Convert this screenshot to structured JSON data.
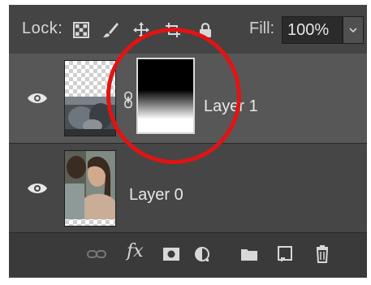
{
  "lockbar": {
    "lock_label": "Lock:",
    "lock_icons": [
      "lock-transparent-pixels-icon",
      "lock-image-pixels-icon",
      "lock-position-icon",
      "artboard-autonest-icon",
      "lock-all-icon"
    ],
    "fill_label": "Fill:",
    "fill_value": "100%"
  },
  "layers": [
    {
      "name": "Layer 1",
      "visible": true,
      "has_mask": true,
      "linked": true,
      "selected": true
    },
    {
      "name": "Layer 0",
      "visible": true,
      "has_mask": false,
      "linked": false,
      "selected": false
    }
  ],
  "footer_icons": [
    "link-layers-icon",
    "fx-icon",
    "add-mask-icon",
    "adjustment-layer-icon",
    "new-group-icon",
    "new-layer-icon",
    "delete-icon"
  ],
  "footer": {
    "fx_label": "fx"
  },
  "annotation": {
    "color": "#e01414",
    "shape": "ellipse"
  },
  "colors": {
    "panel_bg": "#3d3d3d",
    "selected_row": "#575757",
    "row_bg": "#464646",
    "text": "#e8e8e8"
  }
}
